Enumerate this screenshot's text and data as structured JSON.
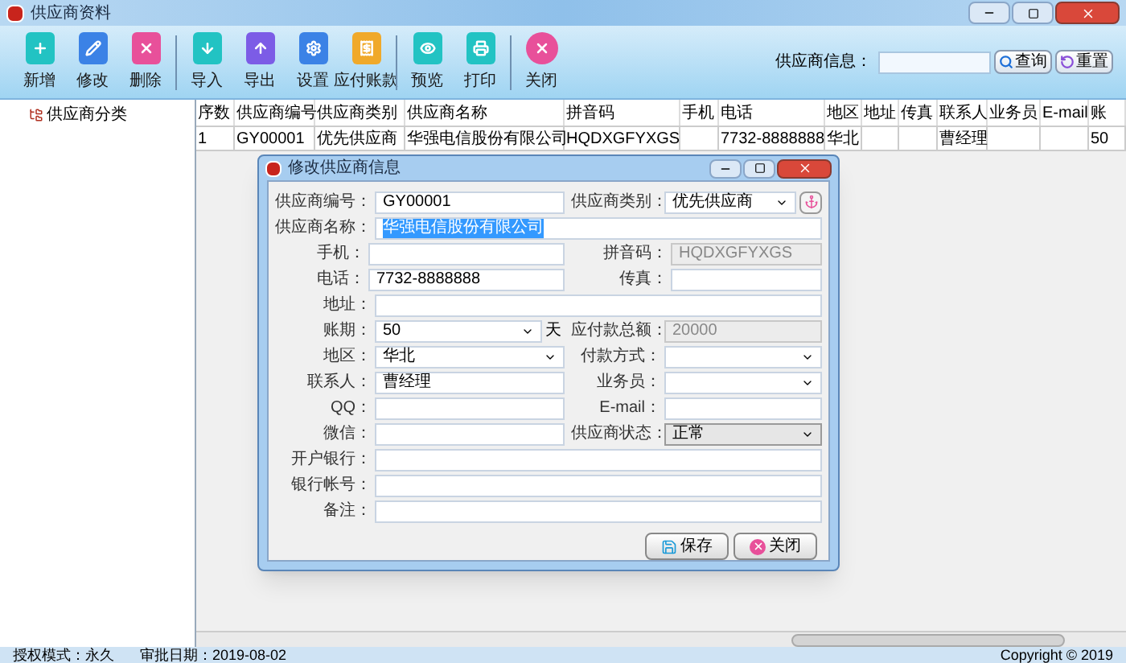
{
  "window": {
    "title": "供应商资料"
  },
  "toolbar": [
    {
      "label": "新增",
      "color": "#22c3c3"
    },
    {
      "label": "修改",
      "color": "#3b82e6"
    },
    {
      "label": "删除",
      "color": "#e8509a"
    },
    {
      "label": "导入",
      "color": "#22c3c3",
      "group_start": true
    },
    {
      "label": "导出",
      "color": "#7c5ce6"
    },
    {
      "label": "设置",
      "color": "#3b82e6"
    },
    {
      "label": "应付账款",
      "color": "#f0a92a"
    },
    {
      "label": "预览",
      "color": "#22c3c3",
      "group_start": true
    },
    {
      "label": "打印",
      "color": "#22c3c3"
    },
    {
      "label": "关闭",
      "color": "#e8509a",
      "group_start": true
    }
  ],
  "search": {
    "label": "供应商信息：",
    "buttons": [
      "查询",
      "重置"
    ]
  },
  "sidebar": {
    "items": [
      {
        "label": "供应商分类"
      }
    ]
  },
  "table": {
    "columns": [
      "序数",
      "供应商编号",
      "供应商类别",
      "供应商名称",
      "拼音码",
      "手机",
      "电话",
      "地区",
      "地址",
      "传真",
      "联系人",
      "业务员",
      "E-mail",
      "账"
    ],
    "rows": [
      [
        "1",
        "GY00001",
        "优先供应商",
        "华强电信股份有限公司",
        "HQDXGFYXGS",
        "",
        "7732-8888888",
        "华北",
        "",
        "",
        "曹经理",
        "",
        "",
        "50"
      ]
    ]
  },
  "dialog": {
    "title": "修改供应商信息",
    "fields": [
      {
        "label": "供应商编号：",
        "value": "GY00001",
        "kind": "text"
      },
      {
        "label": "供应商类别：",
        "value": "优先供应商",
        "kind": "select",
        "extra": true
      },
      {
        "label": "供应商名称：",
        "value": "华强电信股份有限公司",
        "kind": "text",
        "wide": true,
        "highlighted": true
      },
      {
        "label": "手机：",
        "kind": "text"
      },
      {
        "label": "拼音码：",
        "value": "HQDXGFYXGS",
        "kind": "readonly"
      },
      {
        "label": "电话：",
        "value": "7732-8888888",
        "kind": "text"
      },
      {
        "label": "传真：",
        "kind": "text"
      },
      {
        "label": "地址：",
        "kind": "text",
        "wide": true
      },
      {
        "label": "账期：",
        "value": "50",
        "kind": "select",
        "unit": "天"
      },
      {
        "label": "应付款总额：",
        "value": "20000",
        "kind": "readonly"
      },
      {
        "label": "地区：",
        "value": "华北",
        "kind": "select"
      },
      {
        "label": "付款方式：",
        "kind": "select"
      },
      {
        "label": "联系人：",
        "value": "曹经理",
        "kind": "text"
      },
      {
        "label": "业务员：",
        "kind": "select"
      },
      {
        "label": "QQ：",
        "kind": "text"
      },
      {
        "label": "E-mail：",
        "kind": "text"
      },
      {
        "label": "微信：",
        "kind": "text"
      },
      {
        "label": "供应商状态：",
        "value": "正常",
        "kind": "combo"
      },
      {
        "label": "开户银行：",
        "kind": "text",
        "wide": true
      },
      {
        "label": "银行帐号：",
        "kind": "text",
        "wide": true
      },
      {
        "label": "备注：",
        "kind": "text",
        "wide": true
      }
    ],
    "buttons": [
      "保存",
      "关闭"
    ]
  },
  "status_bar": [
    "授权模式：永久",
    "审批日期：2019-08-02",
    "Copyright © 2019"
  ]
}
